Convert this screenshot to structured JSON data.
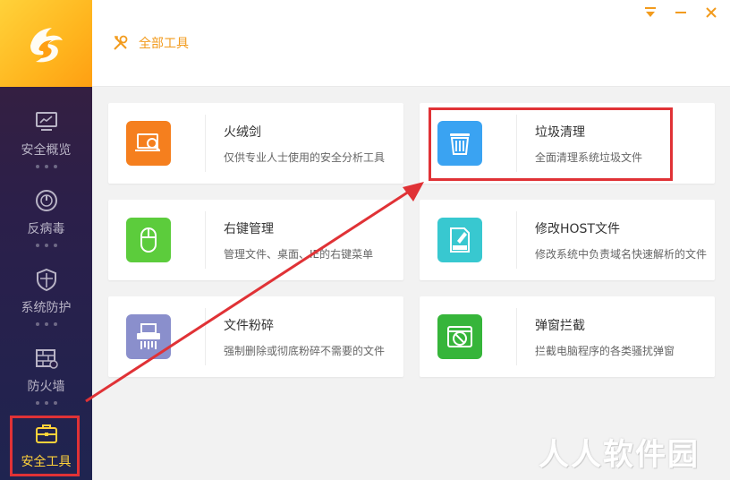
{
  "header": {
    "title": "全部工具",
    "title_icon": "tools-icon"
  },
  "window_controls": [
    {
      "name": "menu",
      "icon": "menu-down-icon"
    },
    {
      "name": "minimize",
      "icon": "minimize-icon"
    },
    {
      "name": "close",
      "icon": "close-icon"
    }
  ],
  "sidebar": {
    "logo": "huorong-logo",
    "items": [
      {
        "label": "安全概览",
        "icon": "monitor-icon"
      },
      {
        "label": "反病毒",
        "icon": "gauge-icon"
      },
      {
        "label": "系统防护",
        "icon": "shield-icon"
      },
      {
        "label": "防火墙",
        "icon": "firewall-icon"
      },
      {
        "label": "安全工具",
        "icon": "toolbox-icon",
        "active": true
      }
    ]
  },
  "tools": [
    {
      "name": "火绒剑",
      "desc": "仅供专业人士使用的安全分析工具",
      "icon": "magnifier-laptop-icon",
      "color": "#f57f1e"
    },
    {
      "name": "垃圾清理",
      "desc": "全面清理系统垃圾文件",
      "icon": "trash-icon",
      "color": "#3aa3f2"
    },
    {
      "name": "右键管理",
      "desc": "管理文件、桌面、IE的右键菜单",
      "icon": "mouse-icon",
      "color": "#5ccc3c"
    },
    {
      "name": "修改HOST文件",
      "desc": "修改系统中负责域名快速解析的文件",
      "icon": "host-file-icon",
      "color": "#38c8d0"
    },
    {
      "name": "文件粉碎",
      "desc": "强制删除或彻底粉碎不需要的文件",
      "icon": "shredder-icon",
      "color": "#8a8fcc"
    },
    {
      "name": "弹窗拦截",
      "desc": "拦截电脑程序的各类骚扰弹窗",
      "icon": "popup-block-icon",
      "color": "#36b53a"
    }
  ],
  "watermark": "人人软件园",
  "colors": {
    "accent": "#ffb51e",
    "highlight": "#e03236",
    "title": "#f29b1d"
  }
}
